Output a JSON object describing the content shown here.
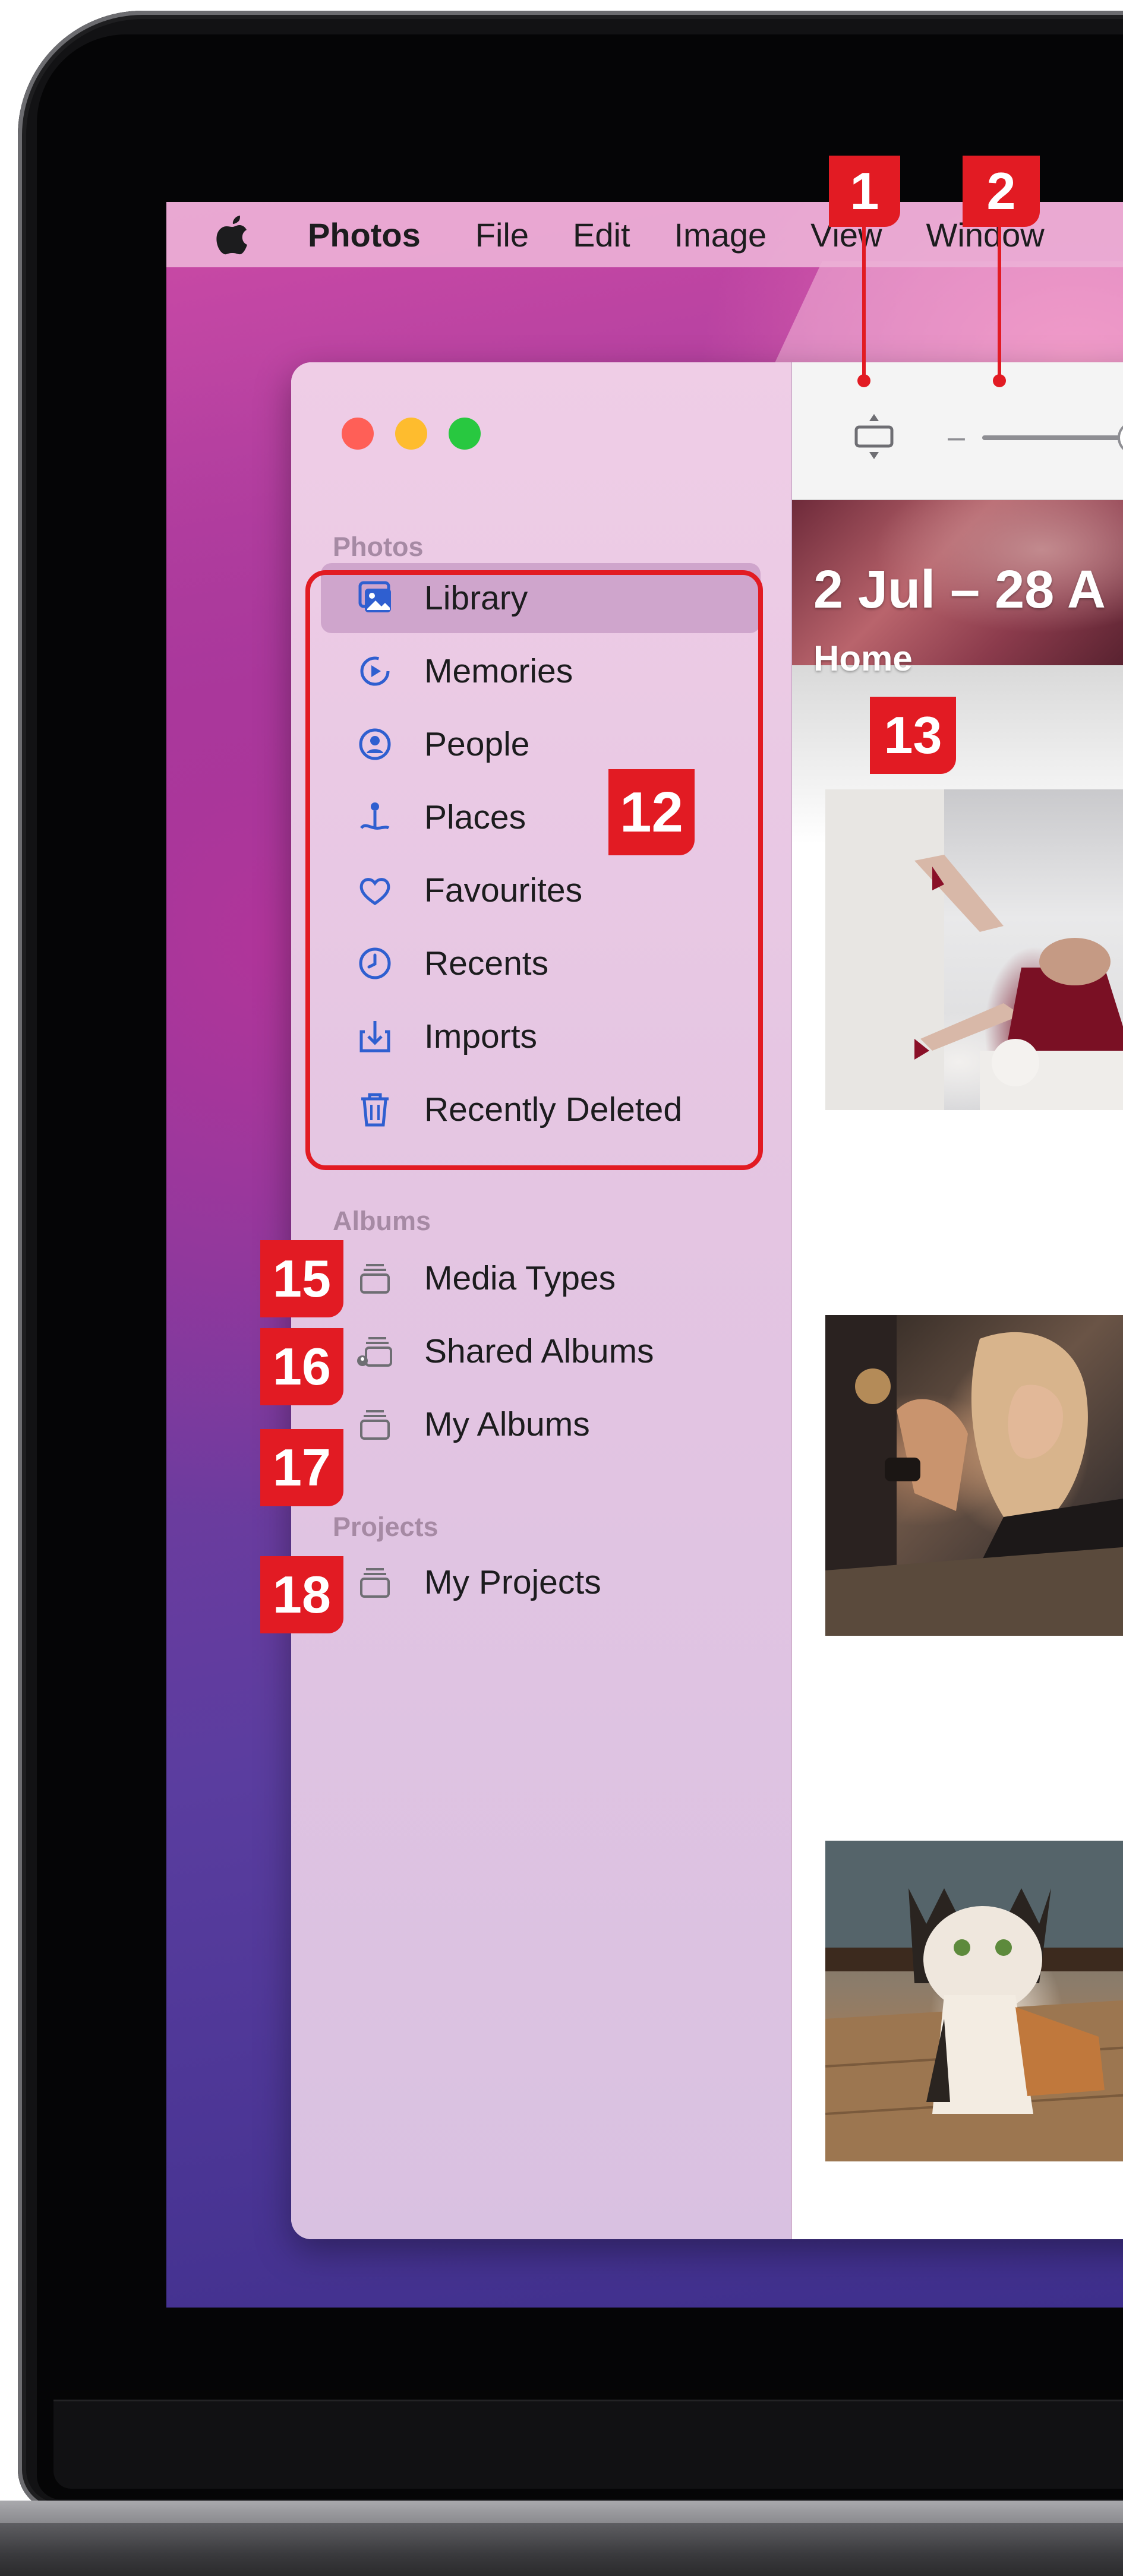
{
  "menubar": {
    "apple_icon": "apple-logo",
    "items": [
      "Photos",
      "File",
      "Edit",
      "Image",
      "View",
      "Window"
    ]
  },
  "window": {
    "traffic_lights": [
      "close",
      "minimize",
      "zoom"
    ],
    "toolbar": {
      "aspect_icon": "aspect-ratio-icon",
      "zoom_minus": "–"
    },
    "header": {
      "date_range": "2 Jul – 28 A",
      "location": "Home"
    },
    "sidebar": {
      "photos_section": "Photos",
      "photos_items": [
        {
          "label": "Library",
          "icon": "library-icon",
          "selected": true
        },
        {
          "label": "Memories",
          "icon": "memories-icon"
        },
        {
          "label": "People",
          "icon": "people-icon"
        },
        {
          "label": "Places",
          "icon": "places-icon"
        },
        {
          "label": "Favourites",
          "icon": "heart-icon"
        },
        {
          "label": "Recents",
          "icon": "clock-icon"
        },
        {
          "label": "Imports",
          "icon": "import-icon"
        },
        {
          "label": "Recently Deleted",
          "icon": "trash-icon"
        }
      ],
      "albums_section": "Albums",
      "album_items": [
        {
          "label": "Media Types",
          "icon": "folder-stack-icon"
        },
        {
          "label": "Shared Albums",
          "icon": "shared-album-icon"
        },
        {
          "label": "My Albums",
          "icon": "folder-stack-icon"
        }
      ],
      "projects_section": "Projects",
      "project_items": [
        {
          "label": "My Projects",
          "icon": "folder-stack-icon"
        }
      ]
    }
  },
  "annotations": {
    "m1": "1",
    "m2": "2",
    "m12": "12",
    "m13": "13",
    "m15": "15",
    "m16": "16",
    "m17": "17",
    "m18": "18"
  },
  "colors": {
    "marker_red": "#e21b23",
    "selected_row": "#cfa5cc",
    "icon_blue": "#2f5fd0"
  }
}
